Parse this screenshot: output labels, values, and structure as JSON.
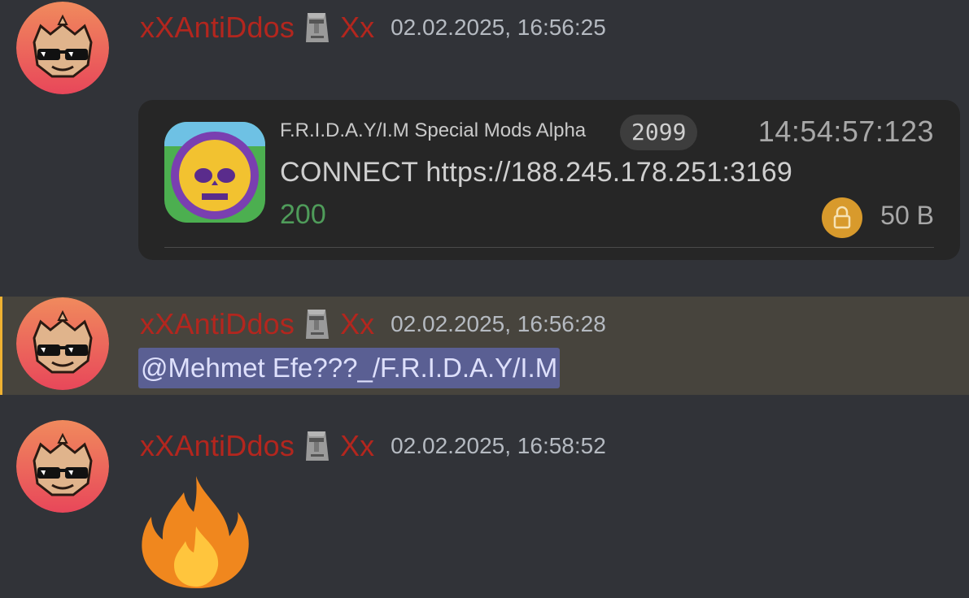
{
  "messages": [
    {
      "username": "xXAntiDdos",
      "username_suffix": "Xx",
      "timestamp": "02.02.2025, 16:56:25",
      "attachment": {
        "app_name": "F.R.I.D.A.Y/I.M Special Mods Alpha",
        "pid": "2099",
        "time": "14:54:57:123",
        "request": "CONNECT https://188.245.178.251:3169",
        "status": "200",
        "size": "50 B"
      }
    },
    {
      "username": "xXAntiDdos",
      "username_suffix": "Xx",
      "timestamp": "02.02.2025, 16:56:28",
      "mention": "@Mehmet Efe???_/F.R.I.D.A.Y/I.M"
    },
    {
      "username": "xXAntiDdos",
      "username_suffix": "Xx",
      "timestamp": "02.02.2025, 16:58:52",
      "emoji": "fire-emoji"
    }
  ],
  "icons": {
    "avatar": "wolf-sunglasses-avatar",
    "username_emoji": "moai-icon",
    "app_icon": "skull-game-icon",
    "lock": "lock-icon"
  },
  "colors": {
    "background": "#313338",
    "username": "#b3261e",
    "mention_highlight_bg": "#47443d",
    "mention_bar": "#f0b232",
    "mention_pill": "#5a5f93",
    "status_ok": "#4f9c5a",
    "lock_badge": "#d89a2c"
  }
}
